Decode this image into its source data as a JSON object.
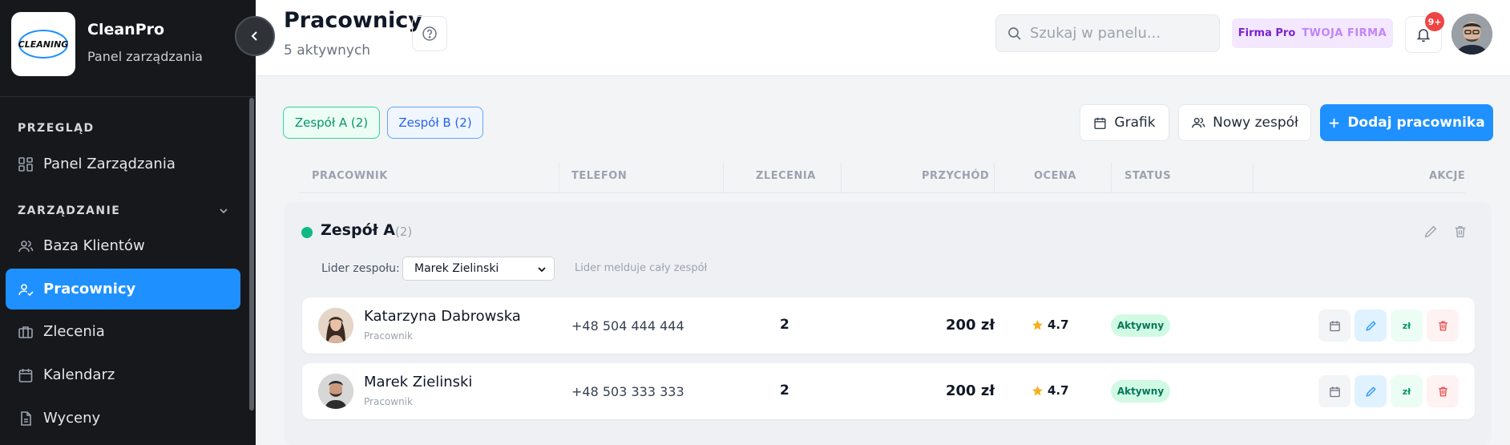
{
  "sidebar": {
    "brand_name": "CleanPro",
    "brand_subtitle": "Panel zarządzania",
    "logo_text": "CLEANING",
    "sections": {
      "overview_label": "PRZEGLĄD",
      "management_label": "ZARZĄDZANIE"
    },
    "items": [
      {
        "label": "Panel Zarządzania",
        "icon": "grid-icon"
      },
      {
        "label": "Baza Klientów",
        "icon": "users-icon"
      },
      {
        "label": "Pracownicy",
        "icon": "user-check-icon",
        "active": true
      },
      {
        "label": "Zlecenia",
        "icon": "briefcase-icon"
      },
      {
        "label": "Kalendarz",
        "icon": "calendar-icon"
      },
      {
        "label": "Wyceny",
        "icon": "file-icon"
      }
    ]
  },
  "header": {
    "title": "Pracownicy",
    "subtitle": "5 aktywnych",
    "search_placeholder": "Szukaj w panelu...",
    "firm_plan": "Firma Pro",
    "firm_name": "TWOJA FIRMA",
    "notification_count": "9+"
  },
  "toolbar": {
    "team_tabs": [
      "Zespół A (2)",
      "Zespół B (2)"
    ],
    "schedule_label": "Grafik",
    "new_team_label": "Nowy zespół",
    "add_employee_label": "Dodaj pracownika"
  },
  "table": {
    "columns": [
      "PRACOWNIK",
      "TELEFON",
      "ZLECENIA",
      "PRZYCHÓD",
      "OCENA",
      "STATUS",
      "AKCJE"
    ]
  },
  "group": {
    "name": "Zespół A",
    "count": "(2)",
    "leader_label": "Lider zespołu:",
    "leader_value": "Marek Zielinski",
    "leader_hint": "Lider melduje cały zespół",
    "dot_color": "#10b981",
    "members": [
      {
        "name": "Katarzyna Dabrowska",
        "role": "Pracownik",
        "phone": "+48 504 444 444",
        "orders": "2",
        "revenue": "200 zł",
        "rating": "4.7",
        "status": "Aktywny"
      },
      {
        "name": "Marek Zielinski",
        "role": "Pracownik",
        "phone": "+48 503 333 333",
        "orders": "2",
        "revenue": "200 zł",
        "rating": "4.7",
        "status": "Aktywny"
      }
    ]
  },
  "actions": {
    "pay_label": "zł"
  },
  "colors": {
    "primary": "#1e90ff",
    "sidebar_bg": "#16181c",
    "success": "#10b981",
    "danger": "#ef4444"
  }
}
